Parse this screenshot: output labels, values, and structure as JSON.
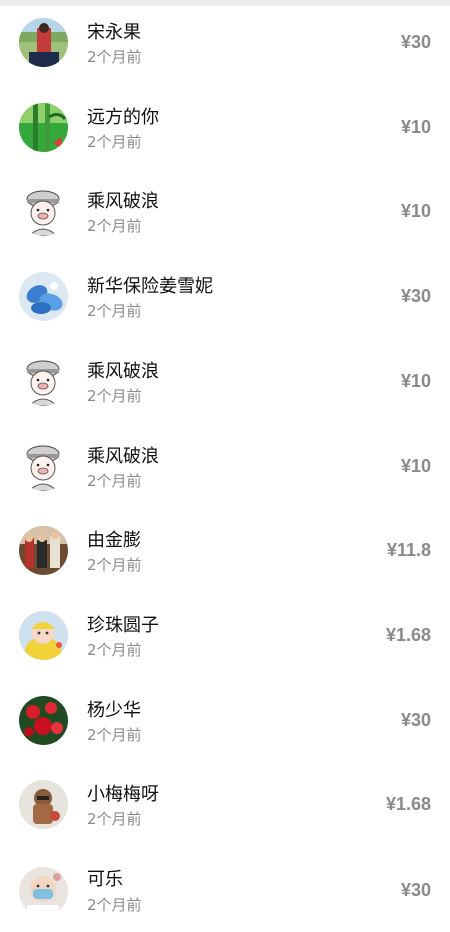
{
  "records": [
    {
      "name": "宋永果",
      "time": "2个月前",
      "amount": "¥30",
      "avatar": "avatar-landscape-person"
    },
    {
      "name": "远方的你",
      "time": "2个月前",
      "amount": "¥10",
      "avatar": "avatar-bamboo"
    },
    {
      "name": "乘风破浪",
      "time": "2个月前",
      "amount": "¥10",
      "avatar": "avatar-cartoon-pig-hat"
    },
    {
      "name": "新华保险姜雪妮",
      "time": "2个月前",
      "amount": "¥30",
      "avatar": "avatar-blue-flowers"
    },
    {
      "name": "乘风破浪",
      "time": "2个月前",
      "amount": "¥10",
      "avatar": "avatar-cartoon-pig-hat"
    },
    {
      "name": "乘风破浪",
      "time": "2个月前",
      "amount": "¥10",
      "avatar": "avatar-cartoon-pig-hat"
    },
    {
      "name": "由金膨",
      "time": "2个月前",
      "amount": "¥11.8",
      "avatar": "avatar-family-photo"
    },
    {
      "name": "珍珠圆子",
      "time": "2个月前",
      "amount": "¥1.68",
      "avatar": "avatar-baby-costume"
    },
    {
      "name": "杨少华",
      "time": "2个月前",
      "amount": "¥30",
      "avatar": "avatar-red-roses"
    },
    {
      "name": "小梅梅呀",
      "time": "2个月前",
      "amount": "¥1.68",
      "avatar": "avatar-child-toy"
    },
    {
      "name": "可乐",
      "time": "2个月前",
      "amount": "¥30",
      "avatar": "avatar-baby-mask"
    }
  ],
  "colors": {
    "name": "#111111",
    "time": "#8c8c8c",
    "amount": "#8a8a8a"
  }
}
